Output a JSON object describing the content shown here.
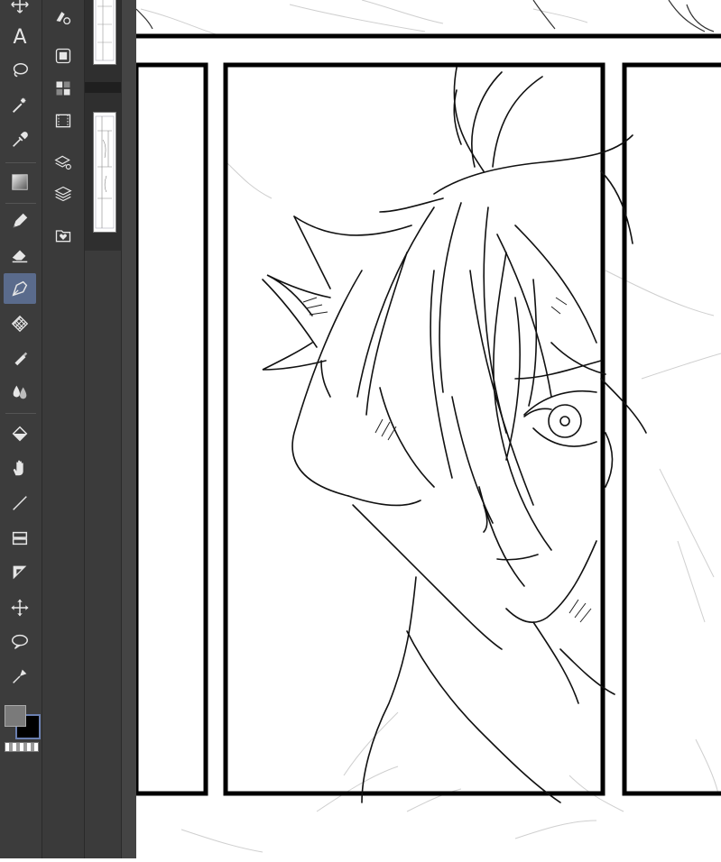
{
  "app": {
    "tools": [
      {
        "id": "move-layer",
        "icon": "move-arrows-icon"
      },
      {
        "id": "text",
        "icon": "text-icon",
        "glyph": "A"
      },
      {
        "id": "lasso-select",
        "icon": "lasso-icon"
      },
      {
        "id": "auto-select",
        "icon": "magic-wand-icon"
      },
      {
        "id": "eyedropper",
        "icon": "eyedropper-icon"
      },
      {
        "id": "gradient",
        "icon": "gradient-icon"
      },
      {
        "id": "pencil",
        "icon": "pencil-icon"
      },
      {
        "id": "eraser",
        "icon": "eraser-icon"
      },
      {
        "id": "pen",
        "icon": "pen-nib-icon",
        "active": true
      },
      {
        "id": "decoration",
        "icon": "pattern-icon"
      },
      {
        "id": "airbrush",
        "icon": "airbrush-icon"
      },
      {
        "id": "blend",
        "icon": "blend-drops-icon"
      },
      {
        "id": "fill",
        "icon": "fill-bucket-icon"
      },
      {
        "id": "hand",
        "icon": "hand-icon"
      },
      {
        "id": "figure",
        "icon": "line-icon"
      },
      {
        "id": "frame-border",
        "icon": "frame-border-icon"
      },
      {
        "id": "ruler",
        "icon": "ruler-icon"
      },
      {
        "id": "object",
        "icon": "object-move-icon"
      },
      {
        "id": "balloon",
        "icon": "speech-balloon-icon"
      },
      {
        "id": "correct-line",
        "icon": "correct-line-icon"
      }
    ],
    "colors": {
      "main_color": "#7a7a7a",
      "sub_color": "#000000",
      "accent": "#5a6b8c"
    },
    "subtool_icons": [
      "pen-settings-icon",
      "layer-property-icon",
      "color-set-icon",
      "animation-timeline-icon",
      "layer-search-icon",
      "layers-icon",
      "material-icon"
    ]
  }
}
